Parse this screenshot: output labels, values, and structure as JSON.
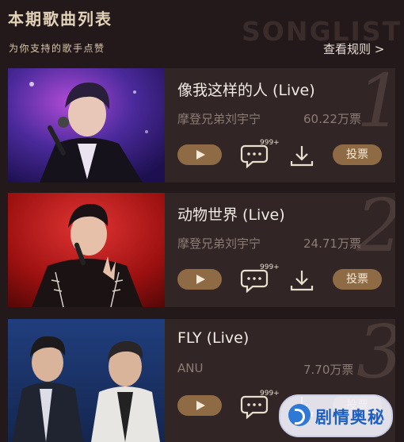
{
  "header": {
    "title": "本期歌曲列表",
    "subtitle": "为你支持的歌手点赞",
    "watermark": "SONGLIST",
    "rules_link": "查看规则 >"
  },
  "songs": [
    {
      "rank": "1",
      "title": "像我这样的人 (Live)",
      "artist": "摩登兄弟刘宇宁",
      "votes": "60.22万票",
      "comments": "999+",
      "vote_label": "投票"
    },
    {
      "rank": "2",
      "title": "动物世界 (Live)",
      "artist": "摩登兄弟刘宇宁",
      "votes": "24.71万票",
      "comments": "999+",
      "vote_label": "投票"
    },
    {
      "rank": "3",
      "title": "FLY (Live)",
      "artist": "ANU",
      "votes": "7.70万票",
      "comments": "999+",
      "vote_label": "投票"
    }
  ],
  "badge": {
    "text": "剧情奥秘"
  },
  "colors": {
    "background": "#24191a",
    "card": "#312526",
    "accent": "#8f6b45",
    "title": "#e2d3b8"
  },
  "icons": {
    "play": "play-icon",
    "comment": "comment-icon",
    "download": "download-icon"
  }
}
